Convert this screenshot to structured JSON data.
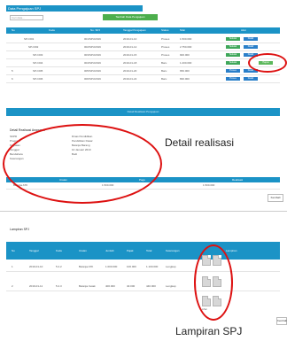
{
  "page": {
    "title": "Data Pengajuan SPJ"
  },
  "search": {
    "placeholder": "Cari data..."
  },
  "header_button": "Tambah Data Pengajuan",
  "main_table": {
    "headers": [
      "No",
      "Kode",
      "No. SPJ",
      "Tanggal Pengajuan",
      "Status",
      "Nilai",
      "Aksi"
    ],
    "rows": [
      {
        "no": "1",
        "kode": "SPJ.001",
        "nospj": "001/SPJ/2019",
        "tgl": "2019-01-10",
        "status": "Proses",
        "nilai": "1.500.000",
        "badges": [
          "Selesai",
          "Detail"
        ]
      },
      {
        "no": "2",
        "kode": "SPJ.002",
        "nospj": "002/SPJ/2019",
        "tgl": "2019-01-12",
        "status": "Proses",
        "nilai": "2.750.000",
        "badges": [
          "Selesai",
          "Detail"
        ]
      },
      {
        "no": "3",
        "kode": "SPJ.003",
        "nospj": "003/SPJ/2019",
        "tgl": "2019-01-15",
        "status": "Proses",
        "nilai": "900.000",
        "badges": [
          "Selesai",
          "Detail"
        ]
      },
      {
        "no": "4",
        "kode": "SPJ.004",
        "nospj": "004/SPJ/2019",
        "tgl": "2019-01-18",
        "status": "Baru",
        "nilai": "1.200.000",
        "badges": [
          "Selesai",
          "Hapus"
        ]
      },
      {
        "no": "5",
        "kode": "SPJ.005",
        "nospj": "005/SPJ/2019",
        "tgl": "2019-01-20",
        "status": "Baru",
        "nilai": "650.000",
        "badges": [
          "Proses",
          "Detail"
        ]
      },
      {
        "no": "6",
        "kode": "SPJ.006",
        "nospj": "006/SPJ/2019",
        "tgl": "2019-01-22",
        "status": "Baru",
        "nilai": "830.000",
        "badges": [
          "Proses",
          "Detail"
        ]
      }
    ]
  },
  "bar2_text": "Detail Realisasi Pengajuan",
  "detail": {
    "section_title": "Detail Realisasi Anggaran",
    "fields": [
      {
        "label": "SKPD",
        "value": "Dinas Pendidikan"
      },
      {
        "label": "Program",
        "value": "Pendidikan Dasar"
      },
      {
        "label": "Kegiatan",
        "value": "Belanja Barang"
      },
      {
        "label": "Tanggal",
        "value": "10 Januari 2019"
      },
      {
        "label": "Bendahara",
        "value": "Budi"
      },
      {
        "label": "Keterangan",
        "value": "-"
      }
    ],
    "table_headers": [
      "Uraian",
      "Pagu",
      "Realisasi"
    ],
    "table_row": [
      "Belanja ATK",
      "1.500.000",
      "1.500.000"
    ],
    "button": "Kembali"
  },
  "annotations": {
    "detail_label": "Detail realisasi",
    "lampiran_label": "Lampiran SPJ"
  },
  "lampiran": {
    "section_title": "Lampiran SPJ",
    "headers": [
      "No",
      "Tanggal",
      "Kode",
      "Uraian",
      "Jumlah",
      "Pajak",
      "Total",
      "Keterangan",
      "Lampiran"
    ],
    "rows": [
      [
        "1",
        "2019-01-10",
        "5.2.2",
        "Belanja ATK",
        "1.000.000",
        "100.000",
        "1.100.000",
        "Lengkap"
      ],
      [
        "2",
        "2019-01-11",
        "5.2.3",
        "Belanja Cetak",
        "400.000",
        "40.000",
        "440.000",
        "Lengkap"
      ]
    ],
    "doc_caption": "Lihat",
    "back_button": "Kembali"
  }
}
